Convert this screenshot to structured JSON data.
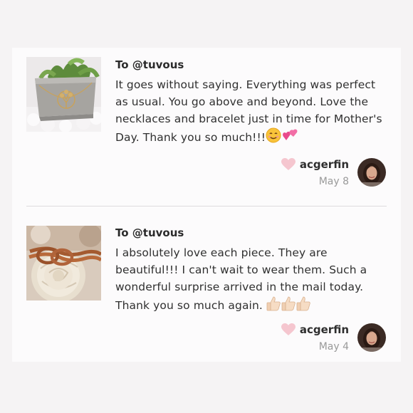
{
  "reviews": [
    {
      "to": "To @tuvous",
      "text": "It goes without saying. Everything was perfect as usual. You go above and beyond. Love the necklaces and bracelet just in time for Mother's Day. Thank you so much!!!",
      "emojis": [
        "smiling-face-icon",
        "two-hearts-icon"
      ],
      "username": "acgerfin",
      "date": "May 8",
      "photo": "tree-necklace-in-concrete-planter"
    },
    {
      "to": "To @tuvous",
      "text": "I absolutely love each piece. They are beautiful!!! I can't wait to wear them. Such a wonderful surprise arrived in the mail today. Thank you so much again.",
      "emojis": [
        "thumbs-up-icon",
        "thumbs-up-icon",
        "thumbs-up-icon"
      ],
      "username": "acgerfin",
      "date": "May 4",
      "photo": "rope-knot-bracelet-on-flower"
    }
  ],
  "colors": {
    "heart": "#f5c6cf",
    "text": "#303030",
    "muted": "#9a9a9a",
    "divider": "#dedcde"
  }
}
